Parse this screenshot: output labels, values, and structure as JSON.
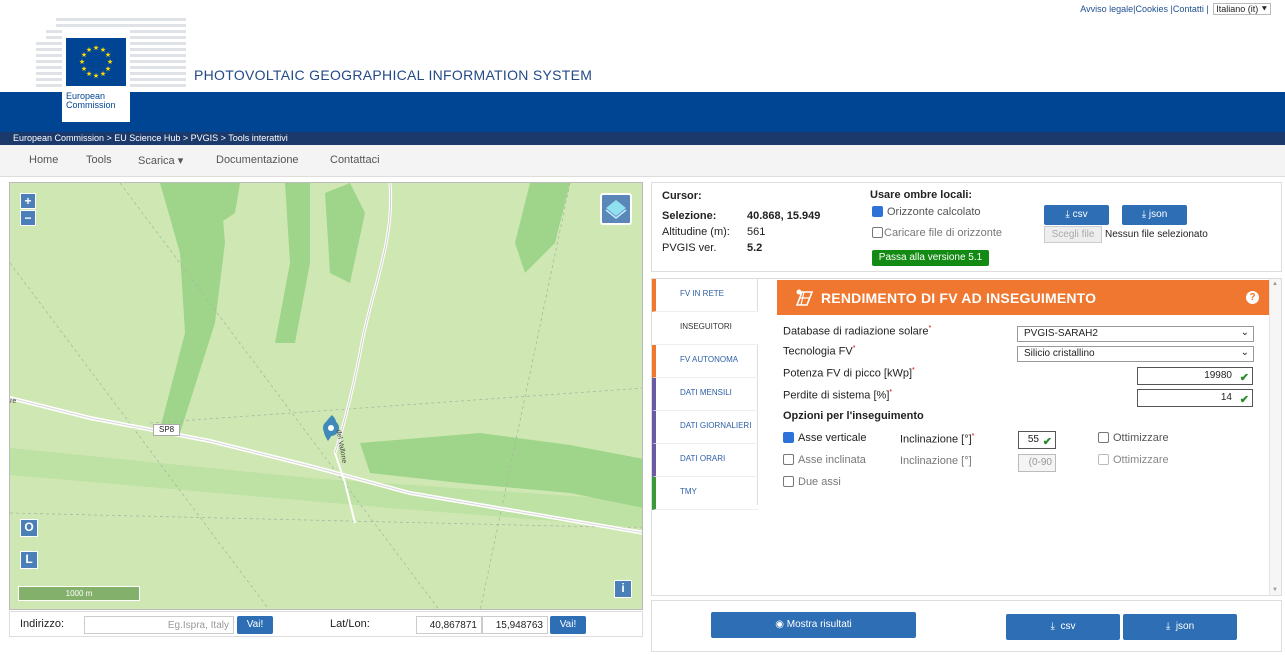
{
  "header": {
    "links": {
      "legal": "Avviso legale",
      "cookies": "|Cookies",
      "contacts": "|Contatti",
      "sep": "|",
      "language": "Italiano (it)"
    },
    "site_title": "PHOTOVOLTAIC GEOGRAPHICAL INFORMATION SYSTEM",
    "logo_line1": "European",
    "logo_line2": "Commission",
    "breadcrumb": "European Commission > EU Science Hub > PVGIS > Tools interattivi"
  },
  "nav": {
    "home": "Home",
    "tools": "Tools",
    "download": "Scarica ▾",
    "docs": "Documentazione",
    "contact": "Contattaci"
  },
  "map": {
    "zoom_in": "+",
    "zoom_out": "−",
    "btn_o": "O",
    "btn_l": "L",
    "btn_i": "i",
    "road_label": "SP8",
    "street_label": "del Vallone",
    "edge_label": "re",
    "scale": "1000 m"
  },
  "address": {
    "label": "Indirizzo:",
    "placeholder": "Eg.Ispra, Italy",
    "go": "Vai!",
    "latlon_label": "Lat/Lon:",
    "lat": "40,867871",
    "lon": "15,948763",
    "go2": "Vai!"
  },
  "info": {
    "cursor_label": "Cursor:",
    "selection_label": "Selezione:",
    "selection_value": "40.868, 15.949",
    "altitude_label": "Altitudine (m):",
    "altitude_value": "561",
    "version_label": "PVGIS ver.",
    "version_value": "5.2",
    "shadows_title": "Usare ombre locali:",
    "horizon_calc": "Orizzonte calcolato",
    "horizon_upload": "Caricare file di orizzonte",
    "choose_file": "Scegli file",
    "no_file": "Nessun file selezionato",
    "switch_version": "Passa alla versione 5.1",
    "csv": "csv",
    "json": "json"
  },
  "tabs": [
    {
      "label": "FV IN RETE",
      "color": "#f0772f"
    },
    {
      "label": "INSEGUITORI",
      "color": "#ffffff"
    },
    {
      "label": "FV AUTONOMA",
      "color": "#f0772f"
    },
    {
      "label": "DATI MENSILI",
      "color": "#6b5aa6"
    },
    {
      "label": "DATI GIORNALIERI",
      "color": "#6b5aa6"
    },
    {
      "label": "DATI ORARI",
      "color": "#6b5aa6"
    },
    {
      "label": "TMY",
      "color": "#3a9a3a"
    }
  ],
  "calc": {
    "title": "RENDIMENTO DI FV AD INSEGUIMENTO",
    "help": "?",
    "db_label": "Database di radiazione solare",
    "db_value": "PVGIS-SARAH2",
    "tech_label": "Tecnologia FV",
    "tech_value": "Silicio cristallino",
    "peak_label": "Potenza FV di picco [kWp]",
    "peak_value": "19980",
    "loss_label": "Perdite di sistema [%]",
    "loss_value": "14",
    "req": "*",
    "options_title": "Opzioni per l'inseguimento",
    "vertical_axis": "Asse verticale",
    "incl_label": "Inclinazione [°]",
    "incl_value": "55",
    "optimize": "Ottimizzare",
    "inclined_axis": "Asse inclinata",
    "incl2_label": "Inclinazione [°]",
    "incl2_placeholder": "(0-90",
    "optimize2": "Ottimizzare",
    "two_axes": "Due assi"
  },
  "bottom": {
    "show_results": "Mostra risultati",
    "csv": "csv",
    "json": "json"
  }
}
